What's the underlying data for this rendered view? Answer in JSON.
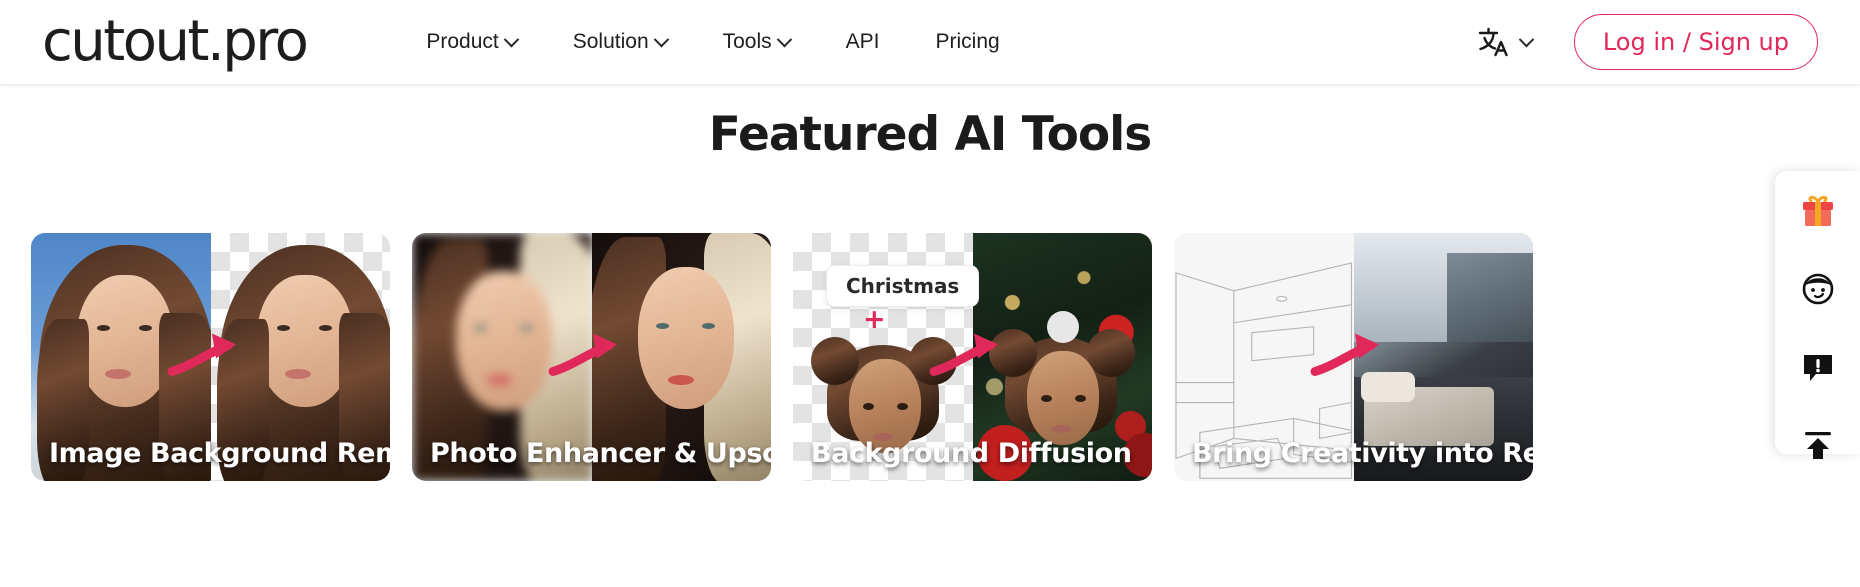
{
  "header": {
    "logo_text": "cutout.pro",
    "nav": [
      {
        "label": "Product",
        "has_dropdown": true
      },
      {
        "label": "Solution",
        "has_dropdown": true
      },
      {
        "label": "Tools",
        "has_dropdown": true
      },
      {
        "label": "API",
        "has_dropdown": false
      },
      {
        "label": "Pricing",
        "has_dropdown": false
      }
    ],
    "language_icon": "translate-icon",
    "login_label": "Log in / Sign up",
    "accent_color": "#e0285a"
  },
  "main": {
    "section_title": "Featured AI Tools",
    "cards": [
      {
        "title": "Image Background Removal"
      },
      {
        "title": "Photo Enhancer & Upscaler"
      },
      {
        "title": "Background Diffusion",
        "badge": "Christmas",
        "plus": "+"
      },
      {
        "title": "Bring Creativity into Reality"
      }
    ]
  },
  "rail": {
    "items": [
      {
        "icon": "gift-icon"
      },
      {
        "icon": "avatar-face-icon"
      },
      {
        "icon": "feedback-icon"
      },
      {
        "icon": "scroll-to-top-icon"
      }
    ]
  }
}
